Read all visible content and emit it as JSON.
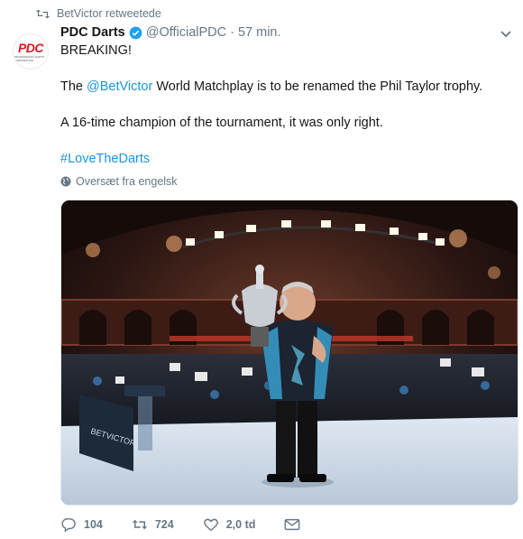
{
  "retweet": {
    "text": "BetVictor retweetede",
    "icon": "retweet-icon"
  },
  "author": {
    "display_name": "PDC Darts",
    "handle": "@OfficialPDC",
    "separator": "·",
    "time": "57 min.",
    "avatar_logo": "PDC",
    "avatar_subtext": "PROFESSIONAL DARTS CORPORATION"
  },
  "tweet": {
    "line1": "BREAKING!",
    "line2_prefix": "The ",
    "line2_mention": "@BetVictor",
    "line2_suffix": " World Matchplay is to be renamed the Phil Taylor trophy.",
    "line3": "A 16-time champion of the tournament, it was only right.",
    "hashtag": "#LoveTheDarts"
  },
  "translate": {
    "label": "Oversæt fra engelsk",
    "icon": "globe-icon"
  },
  "photo": {
    "signage": "BETVICTOR"
  },
  "actions": {
    "replies": "104",
    "retweets": "724",
    "likes": "2,0 td"
  },
  "colors": {
    "link": "#1b95e0",
    "muted": "#657786",
    "text": "#14171a"
  }
}
